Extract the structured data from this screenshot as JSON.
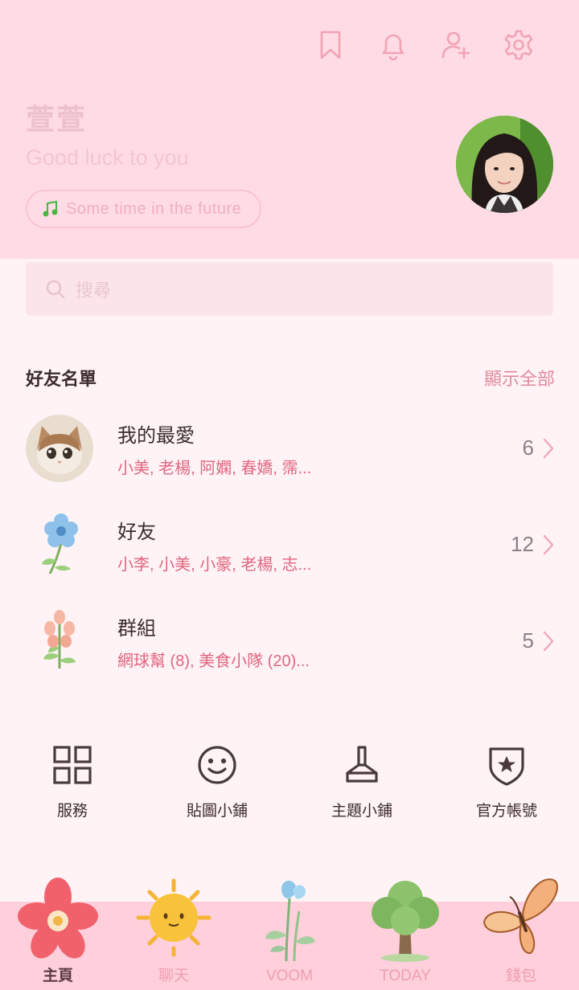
{
  "header": {
    "icons": [
      "bookmark-icon",
      "bell-icon",
      "add-friend-icon",
      "settings-icon"
    ],
    "profile_name": "萱萱",
    "status_message": "Good luck to you",
    "music": "Some time in the future"
  },
  "search": {
    "placeholder": "搜尋"
  },
  "friends": {
    "title": "好友名單",
    "show_all": "顯示全部",
    "rows": [
      {
        "title": "我的最愛",
        "subtitle": "小美, 老楊, 阿嫻, 春嬌, 霈...",
        "count": "6",
        "icon": "cat-avatar"
      },
      {
        "title": "好友",
        "subtitle": "小李, 小美, 小豪, 老楊, 志...",
        "count": "12",
        "icon": "blue-flower-icon"
      },
      {
        "title": "群組",
        "subtitle": "網球幫 (8), 美食小隊 (20)...",
        "count": "5",
        "icon": "pink-flower-icon"
      }
    ]
  },
  "actions": [
    {
      "label": "服務",
      "icon": "grid-icon"
    },
    {
      "label": "貼圖小鋪",
      "icon": "smile-icon"
    },
    {
      "label": "主題小鋪",
      "icon": "brush-icon"
    },
    {
      "label": "官方帳號",
      "icon": "shield-star-icon"
    }
  ],
  "nav": [
    {
      "label": "主頁",
      "icon": "red-flower-icon",
      "active": true
    },
    {
      "label": "聊天",
      "icon": "sun-icon",
      "active": false
    },
    {
      "label": "VOOM",
      "icon": "sprout-icon",
      "active": false
    },
    {
      "label": "TODAY",
      "icon": "tree-icon",
      "active": false
    },
    {
      "label": "錢包",
      "icon": "butterfly-icon",
      "active": false
    }
  ],
  "colors": {
    "header_bg": "#ffdce5",
    "page_bg": "#fff3f6",
    "accent": "#e0667f",
    "nav_bg": "#ffcfdb"
  }
}
